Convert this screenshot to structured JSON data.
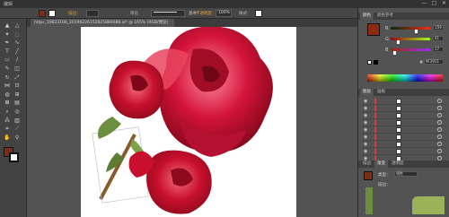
{
  "menubar": {
    "first_item": "编辑",
    "window_controls": [
      "—",
      "□",
      "✕"
    ]
  },
  "control_bar": {
    "stroke_label": "描边：",
    "uniform_label": "等比",
    "basic_label": "基本",
    "opacity_label": "不透明度：",
    "opacity_value": "100%",
    "style_label": "样式："
  },
  "document_tab": {
    "title": "https_10623106_20190226152825880088.ai* @ 165% (RGB/预览)"
  },
  "tools": [
    {
      "icon": "selection-tool-icon",
      "glyph": "▲"
    },
    {
      "icon": "direct-selection-tool-icon",
      "glyph": "△"
    },
    {
      "icon": "magic-wand-tool-icon",
      "glyph": "✦"
    },
    {
      "icon": "lasso-tool-icon",
      "glyph": "◌"
    },
    {
      "icon": "pen-tool-icon",
      "glyph": "✒"
    },
    {
      "icon": "curvature-tool-icon",
      "glyph": "∿"
    },
    {
      "icon": "type-tool-icon",
      "glyph": "T"
    },
    {
      "icon": "line-tool-icon",
      "glyph": "╱"
    },
    {
      "icon": "rectangle-tool-icon",
      "glyph": "▭"
    },
    {
      "icon": "paintbrush-tool-icon",
      "glyph": "∕"
    },
    {
      "icon": "pencil-tool-icon",
      "glyph": "✎"
    },
    {
      "icon": "eraser-tool-icon",
      "glyph": "◫"
    },
    {
      "icon": "rotate-tool-icon",
      "glyph": "↻"
    },
    {
      "icon": "scale-tool-icon",
      "glyph": "⤢"
    },
    {
      "icon": "width-tool-icon",
      "glyph": "⋈"
    },
    {
      "icon": "free-transform-tool-icon",
      "glyph": "⊡"
    },
    {
      "icon": "shape-builder-tool-icon",
      "glyph": "◍"
    },
    {
      "icon": "perspective-tool-icon",
      "glyph": "⊞"
    },
    {
      "icon": "mesh-tool-icon",
      "glyph": "⊠"
    },
    {
      "icon": "gradient-tool-icon",
      "glyph": "▤"
    },
    {
      "icon": "eyedropper-tool-icon",
      "glyph": "⌕"
    },
    {
      "icon": "blend-tool-icon",
      "glyph": "◎"
    },
    {
      "icon": "symbol-sprayer-tool-icon",
      "glyph": "⁂"
    },
    {
      "icon": "graph-tool-icon",
      "glyph": "▥"
    },
    {
      "icon": "artboard-tool-icon",
      "glyph": "⌗"
    },
    {
      "icon": "slice-tool-icon",
      "glyph": "⟋"
    },
    {
      "icon": "hand-tool-icon",
      "glyph": "✋"
    },
    {
      "icon": "zoom-tool-icon",
      "glyph": "⚲"
    }
  ],
  "fill_stroke": {
    "fill_color": "#7a2e16",
    "stroke_color": "#ffffff"
  },
  "color_panel": {
    "tabs": [
      "颜色",
      "颜色参考"
    ],
    "fill_color": "#8b2a10",
    "sliders": [
      {
        "label": "R",
        "value": "159",
        "level": 0.62
      },
      {
        "label": "G",
        "value": "41",
        "level": 0.16
      },
      {
        "label": "B",
        "value": "17",
        "level": 0.07
      }
    ],
    "hex_prefix": "#",
    "hex_value": "9F2911"
  },
  "layers_panel": {
    "tabs": [
      "图层",
      "画板"
    ],
    "rows": 9
  },
  "brush_panel": {
    "tabs": [
      "描边",
      "渐变",
      "透明度"
    ],
    "label_a": "类型：",
    "value_a": "线性",
    "label_b": "描边："
  },
  "artwork": {
    "rose_dark": "#8e0a1c",
    "rose_mid": "#c8102e",
    "rose_light": "#e94560",
    "stem_color": "#8a5a2a",
    "leaf_color": "#6b8f3e"
  }
}
